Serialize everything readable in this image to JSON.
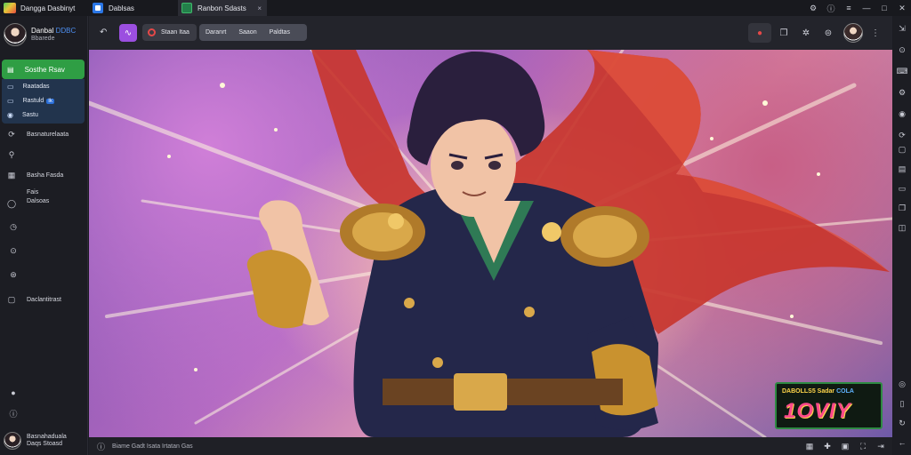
{
  "window": {
    "app_title": "Dangga Dasbinyt",
    "tabs": [
      {
        "label": "Dablsas"
      },
      {
        "label": "Ranbon Sdasts",
        "close": "×"
      }
    ],
    "controls": {
      "min": "—",
      "max": "□",
      "close": "✕"
    }
  },
  "profile": {
    "name": "Danbal",
    "name_accent": "DDBC",
    "subtitle": "Bbarede"
  },
  "nav": {
    "primary": "Sosthe Rsav",
    "subs": [
      {
        "label": "Raatadas",
        "badge": ""
      },
      {
        "label": "Rastuld",
        "badge": "Ik"
      },
      {
        "label": "Sastu",
        "badge": ""
      }
    ],
    "items": [
      {
        "label": "Basnaturelaata"
      },
      {
        "label": ""
      },
      {
        "label": "Basha Fasda"
      },
      {
        "label": "Fais Dalsoas"
      },
      {
        "label": "Daclantitrast"
      }
    ]
  },
  "user_footer": {
    "line1": "Basnahaduala",
    "line2": "Daqs Stoasd"
  },
  "toolbar": {
    "pill_label": "Staan Itaa",
    "segments": [
      "Daranrt",
      "Saaon",
      "Paldtas"
    ]
  },
  "promo": {
    "line_a": "DABOLLS5 Sadar",
    "line_b": "COLA",
    "big": "1OVIY"
  },
  "status": {
    "text": "Biame  Gadt  Isata Irtatan  Gas"
  },
  "colors": {
    "accent_green": "#2f9e44",
    "accent_blue": "#2b77e6",
    "accent_purple": "#9b4fe0",
    "record_red": "#e54848"
  }
}
